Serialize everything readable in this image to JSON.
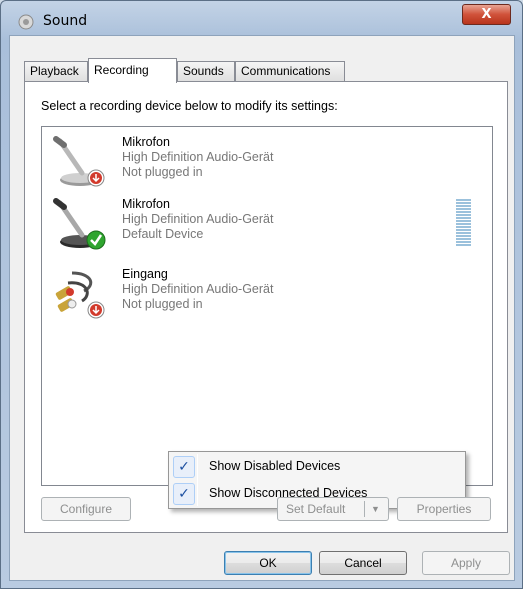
{
  "window": {
    "title": "Sound",
    "close_label": "X"
  },
  "tabs": [
    {
      "label": "Playback",
      "active": false
    },
    {
      "label": "Recording",
      "active": true
    },
    {
      "label": "Sounds",
      "active": false
    },
    {
      "label": "Communications",
      "active": false
    }
  ],
  "recording": {
    "instruction": "Select a recording device below to modify its settings:",
    "devices": [
      {
        "name": "Mikrofon",
        "driver": "High Definition Audio-Gerät",
        "status": "Not plugged in",
        "icon": "microphone-icon",
        "badge": "unplugged-badge-icon"
      },
      {
        "name": "Mikrofon",
        "driver": "High Definition Audio-Gerät",
        "status": "Default Device",
        "icon": "microphone-icon",
        "badge": "default-check-icon"
      },
      {
        "name": "Eingang",
        "driver": "High Definition Audio-Gerät",
        "status": "Not plugged in",
        "icon": "rca-cable-icon",
        "badge": "unplugged-badge-icon"
      }
    ],
    "context_menu": [
      {
        "label": "Show Disabled Devices",
        "checked": true
      },
      {
        "label": "Show Disconnected Devices",
        "checked": true
      }
    ]
  },
  "panel_buttons": {
    "configure": "Configure",
    "set_default": "Set Default",
    "properties": "Properties"
  },
  "dialog_buttons": {
    "ok": "OK",
    "cancel": "Cancel",
    "apply": "Apply"
  },
  "colors": {
    "accent": "#3c7fb1",
    "default_check": "#2fa52f",
    "unplugged": "#d23a2c",
    "level_meter": "#9bc1dc"
  }
}
